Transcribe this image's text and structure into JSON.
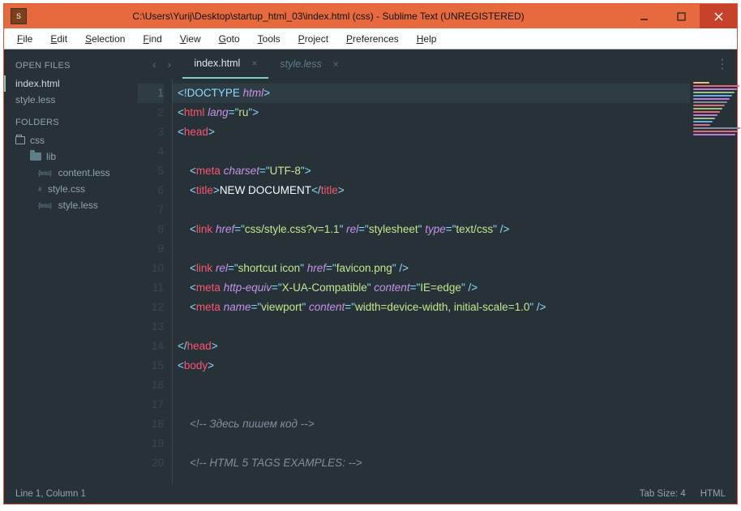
{
  "window": {
    "title": "C:\\Users\\Yurij\\Desktop\\startup_html_03\\index.html (css) - Sublime Text (UNREGISTERED)"
  },
  "menu": [
    "File",
    "Edit",
    "Selection",
    "Find",
    "View",
    "Goto",
    "Tools",
    "Project",
    "Preferences",
    "Help"
  ],
  "sidebar": {
    "openFilesHeading": "OPEN FILES",
    "openFiles": [
      {
        "label": "index.html",
        "active": true
      },
      {
        "label": "style.less",
        "active": false
      }
    ],
    "foldersHeading": "FOLDERS",
    "tree": {
      "root": "css",
      "children": [
        {
          "type": "folder",
          "label": "lib"
        },
        {
          "type": "file",
          "badge": "{less}",
          "label": "content.less"
        },
        {
          "type": "file",
          "badge": "#",
          "label": "style.css"
        },
        {
          "type": "file",
          "badge": "{less}",
          "label": "style.less"
        }
      ]
    }
  },
  "tabs": [
    {
      "label": "index.html",
      "active": true
    },
    {
      "label": "style.less",
      "active": false
    }
  ],
  "code": {
    "lines": [
      {
        "n": 1,
        "active": true,
        "tokens": [
          {
            "c": "p-punc",
            "t": "<"
          },
          {
            "c": "p-doc",
            "t": "!DOCTYPE"
          },
          {
            "c": "p-text",
            "t": " "
          },
          {
            "c": "p-attr",
            "t": "html"
          },
          {
            "c": "p-punc",
            "t": ">"
          }
        ]
      },
      {
        "n": 2,
        "tokens": [
          {
            "c": "p-punc",
            "t": "<"
          },
          {
            "c": "p-tag",
            "t": "html"
          },
          {
            "c": "p-text",
            "t": " "
          },
          {
            "c": "p-attr",
            "t": "lang"
          },
          {
            "c": "p-punc",
            "t": "="
          },
          {
            "c": "p-punc",
            "t": "\""
          },
          {
            "c": "p-str",
            "t": "ru"
          },
          {
            "c": "p-punc",
            "t": "\""
          },
          {
            "c": "p-punc",
            "t": ">"
          }
        ]
      },
      {
        "n": 3,
        "tokens": [
          {
            "c": "p-punc",
            "t": "<"
          },
          {
            "c": "p-tag",
            "t": "head"
          },
          {
            "c": "p-punc",
            "t": ">"
          }
        ]
      },
      {
        "n": 4,
        "tokens": []
      },
      {
        "n": 5,
        "indent": 1,
        "tokens": [
          {
            "c": "p-punc",
            "t": "<"
          },
          {
            "c": "p-tag",
            "t": "meta"
          },
          {
            "c": "p-text",
            "t": " "
          },
          {
            "c": "p-attr",
            "t": "charset"
          },
          {
            "c": "p-punc",
            "t": "="
          },
          {
            "c": "p-punc",
            "t": "\""
          },
          {
            "c": "p-str",
            "t": "UTF-8"
          },
          {
            "c": "p-punc",
            "t": "\""
          },
          {
            "c": "p-punc",
            "t": ">"
          }
        ]
      },
      {
        "n": 6,
        "indent": 1,
        "tokens": [
          {
            "c": "p-punc",
            "t": "<"
          },
          {
            "c": "p-tag",
            "t": "title"
          },
          {
            "c": "p-punc",
            "t": ">"
          },
          {
            "c": "p-text",
            "t": "NEW DOCUMENT"
          },
          {
            "c": "p-punc",
            "t": "</"
          },
          {
            "c": "p-tag",
            "t": "title"
          },
          {
            "c": "p-punc",
            "t": ">"
          }
        ]
      },
      {
        "n": 7,
        "tokens": []
      },
      {
        "n": 8,
        "indent": 1,
        "tokens": [
          {
            "c": "p-punc",
            "t": "<"
          },
          {
            "c": "p-tag",
            "t": "link"
          },
          {
            "c": "p-text",
            "t": " "
          },
          {
            "c": "p-attr",
            "t": "href"
          },
          {
            "c": "p-punc",
            "t": "="
          },
          {
            "c": "p-punc",
            "t": "\""
          },
          {
            "c": "p-str",
            "t": "css/style.css?v=1.1"
          },
          {
            "c": "p-punc",
            "t": "\""
          },
          {
            "c": "p-text",
            "t": " "
          },
          {
            "c": "p-attr",
            "t": "rel"
          },
          {
            "c": "p-punc",
            "t": "="
          },
          {
            "c": "p-punc",
            "t": "\""
          },
          {
            "c": "p-str",
            "t": "stylesheet"
          },
          {
            "c": "p-punc",
            "t": "\""
          },
          {
            "c": "p-text",
            "t": " "
          },
          {
            "c": "p-attr",
            "t": "type"
          },
          {
            "c": "p-punc",
            "t": "="
          },
          {
            "c": "p-punc",
            "t": "\""
          },
          {
            "c": "p-str",
            "t": "text/css"
          },
          {
            "c": "p-punc",
            "t": "\""
          },
          {
            "c": "p-text",
            "t": " "
          },
          {
            "c": "p-punc",
            "t": "/>"
          }
        ]
      },
      {
        "n": 9,
        "tokens": []
      },
      {
        "n": 10,
        "indent": 1,
        "tokens": [
          {
            "c": "p-punc",
            "t": "<"
          },
          {
            "c": "p-tag",
            "t": "link"
          },
          {
            "c": "p-text",
            "t": " "
          },
          {
            "c": "p-attr",
            "t": "rel"
          },
          {
            "c": "p-punc",
            "t": "="
          },
          {
            "c": "p-punc",
            "t": "\""
          },
          {
            "c": "p-str",
            "t": "shortcut icon"
          },
          {
            "c": "p-punc",
            "t": "\""
          },
          {
            "c": "p-text",
            "t": " "
          },
          {
            "c": "p-attr",
            "t": "href"
          },
          {
            "c": "p-punc",
            "t": "="
          },
          {
            "c": "p-punc",
            "t": "\""
          },
          {
            "c": "p-str",
            "t": "favicon.png"
          },
          {
            "c": "p-punc",
            "t": "\""
          },
          {
            "c": "p-text",
            "t": " "
          },
          {
            "c": "p-punc",
            "t": "/>"
          }
        ]
      },
      {
        "n": 11,
        "indent": 1,
        "tokens": [
          {
            "c": "p-punc",
            "t": "<"
          },
          {
            "c": "p-tag",
            "t": "meta"
          },
          {
            "c": "p-text",
            "t": " "
          },
          {
            "c": "p-attr",
            "t": "http-equiv"
          },
          {
            "c": "p-punc",
            "t": "="
          },
          {
            "c": "p-punc",
            "t": "\""
          },
          {
            "c": "p-str",
            "t": "X-UA-Compatible"
          },
          {
            "c": "p-punc",
            "t": "\""
          },
          {
            "c": "p-text",
            "t": " "
          },
          {
            "c": "p-attr",
            "t": "content"
          },
          {
            "c": "p-punc",
            "t": "="
          },
          {
            "c": "p-punc",
            "t": "\""
          },
          {
            "c": "p-str",
            "t": "IE=edge"
          },
          {
            "c": "p-punc",
            "t": "\""
          },
          {
            "c": "p-text",
            "t": " "
          },
          {
            "c": "p-punc",
            "t": "/>"
          }
        ]
      },
      {
        "n": 12,
        "indent": 1,
        "tokens": [
          {
            "c": "p-punc",
            "t": "<"
          },
          {
            "c": "p-tag",
            "t": "meta"
          },
          {
            "c": "p-text",
            "t": " "
          },
          {
            "c": "p-attr",
            "t": "name"
          },
          {
            "c": "p-punc",
            "t": "="
          },
          {
            "c": "p-punc",
            "t": "\""
          },
          {
            "c": "p-str",
            "t": "viewport"
          },
          {
            "c": "p-punc",
            "t": "\""
          },
          {
            "c": "p-text",
            "t": " "
          },
          {
            "c": "p-attr",
            "t": "content"
          },
          {
            "c": "p-punc",
            "t": "="
          },
          {
            "c": "p-punc",
            "t": "\""
          },
          {
            "c": "p-str",
            "t": "width=device-width, initial-scale=1.0"
          },
          {
            "c": "p-punc",
            "t": "\""
          },
          {
            "c": "p-text",
            "t": " "
          },
          {
            "c": "p-punc",
            "t": "/>"
          }
        ]
      },
      {
        "n": 13,
        "tokens": []
      },
      {
        "n": 14,
        "tokens": [
          {
            "c": "p-punc",
            "t": "</"
          },
          {
            "c": "p-tag",
            "t": "head"
          },
          {
            "c": "p-punc",
            "t": ">"
          }
        ]
      },
      {
        "n": 15,
        "tokens": [
          {
            "c": "p-punc",
            "t": "<"
          },
          {
            "c": "p-tag",
            "t": "body"
          },
          {
            "c": "p-punc",
            "t": ">"
          }
        ]
      },
      {
        "n": 16,
        "tokens": []
      },
      {
        "n": 17,
        "tokens": []
      },
      {
        "n": 18,
        "indent": 1,
        "tokens": [
          {
            "c": "p-com",
            "t": "<!-- Здесь пишем код -->"
          }
        ]
      },
      {
        "n": 19,
        "tokens": []
      },
      {
        "n": 20,
        "indent": 1,
        "tokens": [
          {
            "c": "p-com",
            "t": "<!-- HTML 5 TAGS EXAMPLES: -->"
          }
        ]
      }
    ]
  },
  "status": {
    "pos": "Line 1, Column 1",
    "tab": "Tab Size: 4",
    "lang": "HTML"
  },
  "minimapColors": [
    "#e6c07b",
    "#e06c75",
    "#c678dd",
    "#98c379",
    "#61afef",
    "#c678dd",
    "#808fa0",
    "#e06c75",
    "#98c379",
    "#e06c75",
    "#c678dd",
    "#98c379",
    "#61afef",
    "#e06c75",
    "#808fa0",
    "#e06c75",
    "#c678dd"
  ]
}
